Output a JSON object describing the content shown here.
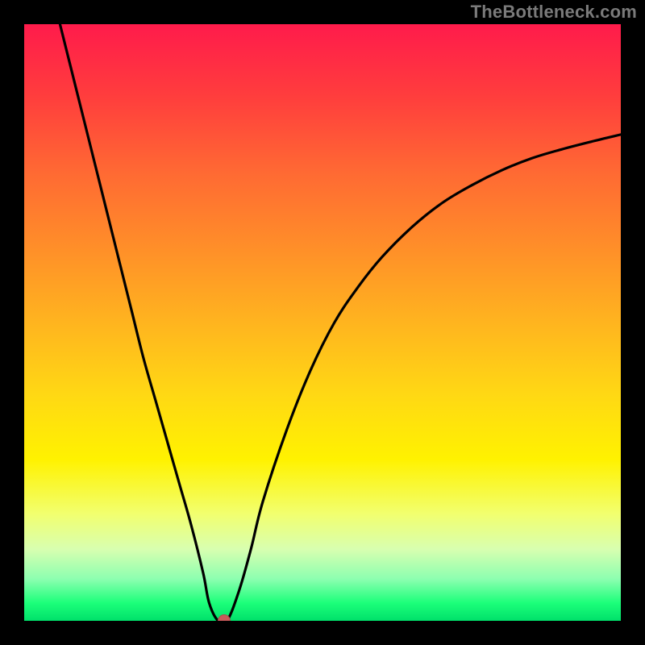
{
  "watermark": "TheBottleneck.com",
  "chart_data": {
    "type": "line",
    "title": "",
    "xlabel": "",
    "ylabel": "",
    "x_range": [
      0,
      100
    ],
    "y_range": [
      0,
      100
    ],
    "grid": false,
    "legend": false,
    "background": "rainbow-gradient",
    "series": [
      {
        "name": "curve",
        "x": [
          6,
          8,
          10,
          12,
          14,
          16,
          18,
          20,
          22,
          24,
          26,
          28,
          30,
          31,
          32.5,
          34,
          36,
          38,
          40,
          44,
          48,
          52,
          56,
          60,
          65,
          70,
          75,
          80,
          85,
          90,
          95,
          100
        ],
        "y": [
          100,
          92,
          84,
          76,
          68,
          60,
          52,
          44,
          37,
          30,
          23,
          16,
          8,
          3,
          0,
          0,
          5,
          12,
          20,
          32,
          42,
          50,
          56,
          61,
          66,
          70,
          73,
          75.5,
          77.5,
          79,
          80.3,
          81.5
        ]
      }
    ],
    "marker": {
      "x": 33.5,
      "y": 0,
      "color": "#c85a5a"
    }
  },
  "colors": {
    "frame": "#000000",
    "watermark": "#7a7a7a",
    "curve": "#000000",
    "marker": "#c85a5a"
  }
}
